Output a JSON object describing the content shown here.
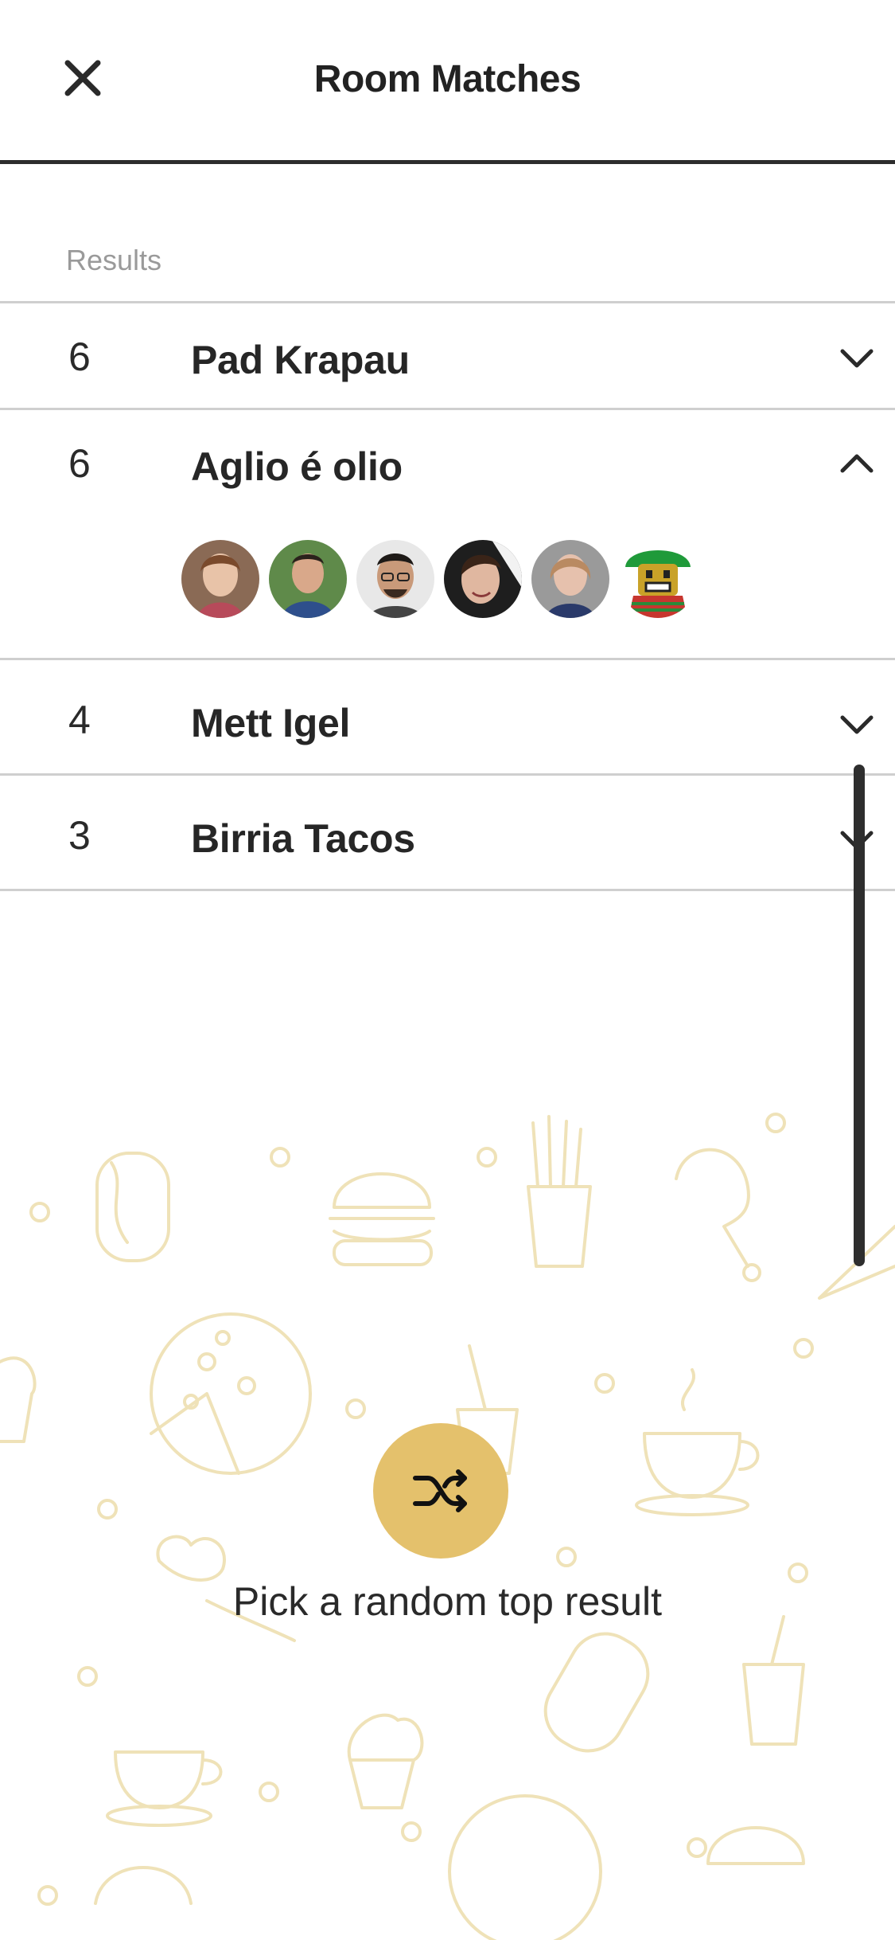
{
  "header": {
    "title": "Room Matches",
    "close_icon": "close-icon"
  },
  "section": {
    "label": "Results"
  },
  "results": [
    {
      "count": "6",
      "name": "Pad Krapau",
      "expanded": false
    },
    {
      "count": "6",
      "name": "Aglio é olio",
      "expanded": true,
      "avatars": 6
    },
    {
      "count": "4",
      "name": "Mett Igel",
      "expanded": false
    },
    {
      "count": "3",
      "name": "Birria Tacos",
      "expanded": false
    }
  ],
  "random": {
    "label": "Pick a random top result",
    "icon": "shuffle-icon"
  },
  "colors": {
    "accent": "#e4c16c",
    "doodle": "#efe2b8",
    "divider": "#cfcfcf"
  }
}
